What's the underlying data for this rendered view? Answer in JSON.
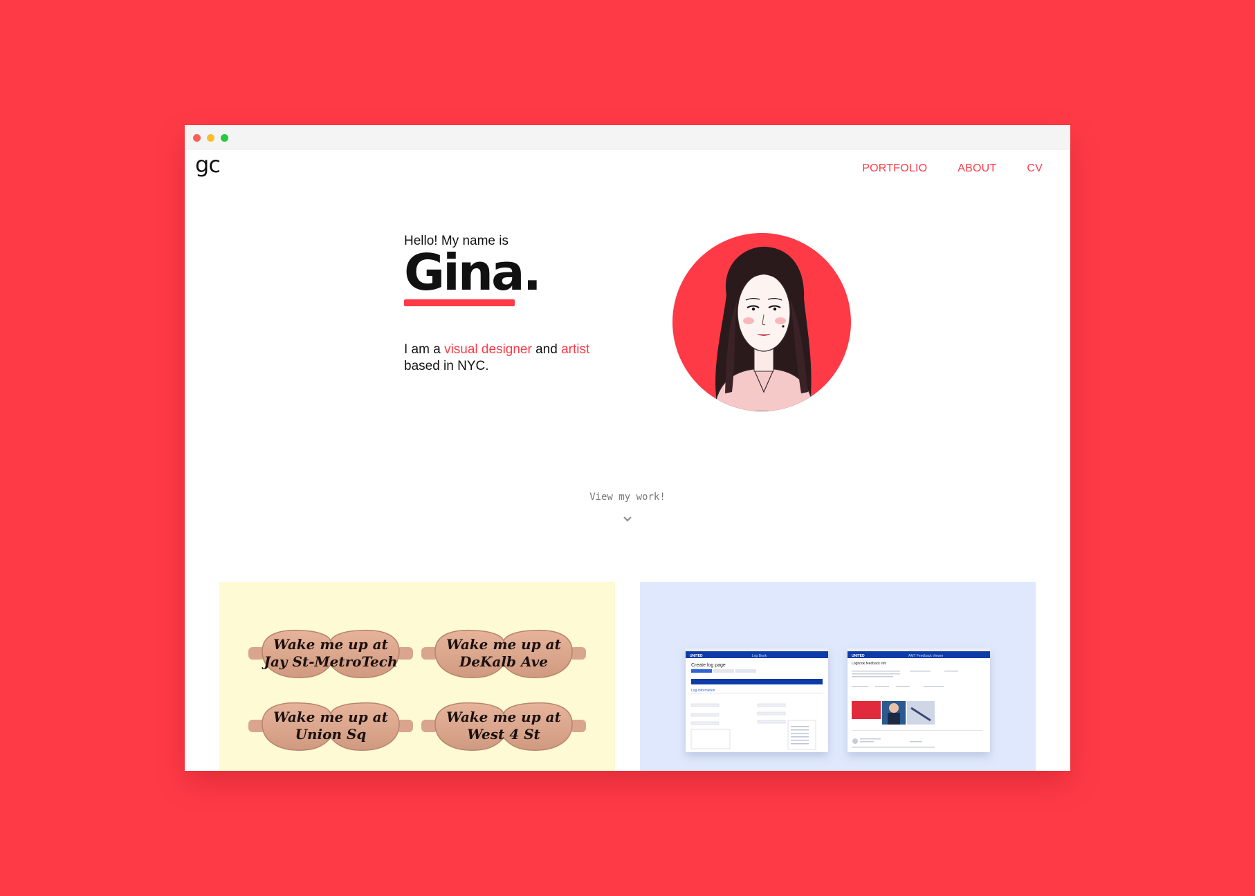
{
  "window": {
    "controls": [
      "close",
      "minimize",
      "maximize"
    ]
  },
  "nav": {
    "logo": "gc",
    "links": [
      {
        "label": "PORTFOLIO"
      },
      {
        "label": "ABOUT"
      },
      {
        "label": "CV"
      }
    ]
  },
  "hero": {
    "greeting": "Hello! My name is",
    "name": "Gina",
    "name_period": ".",
    "tagline_pre": "I am a ",
    "tagline_accent1": "visual designer",
    "tagline_mid": " and ",
    "tagline_accent2": "artist",
    "tagline_post": "based in NYC."
  },
  "cta": {
    "label": "View my work!"
  },
  "projects": [
    {
      "masks": [
        {
          "line1": "Wake me up at",
          "line2": "Jay St-MetroTech"
        },
        {
          "line1": "Wake me up at",
          "line2": "DeKalb Ave"
        },
        {
          "line1": "Wake me up at",
          "line2": "Union Sq"
        },
        {
          "line1": "Wake me up at",
          "line2": "West 4 St"
        }
      ]
    },
    {
      "screens": [
        {
          "brand": "UNITED",
          "header": "Log Book",
          "title": "Create log page",
          "section": "Log information"
        },
        {
          "brand": "UNITED",
          "header": "AMT Feedback Viewer",
          "title": "Logbook feedback info"
        }
      ]
    }
  ],
  "colors": {
    "accent": "#ff3a47",
    "text": "#111111",
    "card_yellow": "#fdfad4",
    "card_blue": "#dfe8fc",
    "united_blue": "#0a3ba8"
  }
}
